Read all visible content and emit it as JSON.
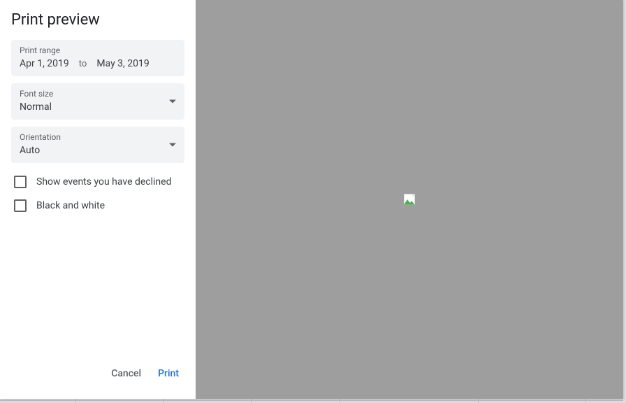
{
  "title": "Print preview",
  "range": {
    "label": "Print range",
    "start": "Apr 1, 2019",
    "to": "to",
    "end": "May 3, 2019"
  },
  "font_size": {
    "label": "Font size",
    "value": "Normal"
  },
  "orientation": {
    "label": "Orientation",
    "value": "Auto"
  },
  "checkboxes": {
    "declined": "Show events you have declined",
    "bw": "Black and white"
  },
  "actions": {
    "cancel": "Cancel",
    "print": "Print"
  }
}
